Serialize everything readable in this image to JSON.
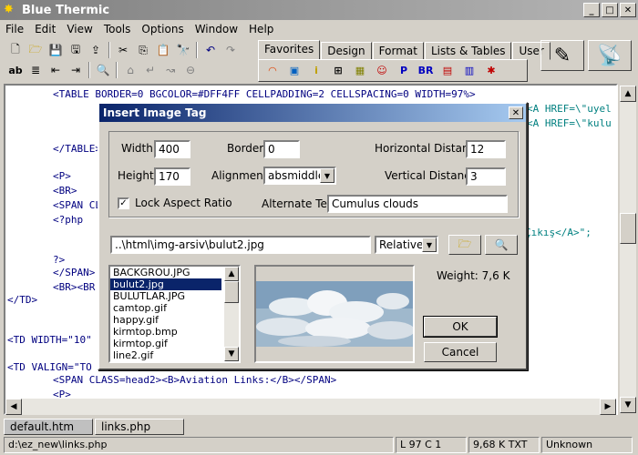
{
  "window": {
    "title": "Blue Thermic"
  },
  "menu": [
    "File",
    "Edit",
    "View",
    "Tools",
    "Options",
    "Window",
    "Help"
  ],
  "tabs": [
    "Favorites",
    "Design",
    "Format",
    "Lists & Tables",
    "User"
  ],
  "tab_icons": {
    "p": "P",
    "br": "BR"
  },
  "editor": {
    "lines": [
      "<TABLE BORDER=0 BGCOLOR=#DFF4FF CELLPADDING=2 CELLSPACING=0 WIDTH=97%>",
      "<A HREF=\\\"uyel",
      "<A HREF=\\\"kulu",
      "</TABLE>",
      "<P>",
      "<BR>",
      "<SPAN CL",
      "<?php",
      "Çıkış</A>\";",
      "?>",
      "</SPAN>",
      "<BR><BR",
      "</TD>",
      "<TD WIDTH=\"10\"",
      "<TD VALIGN=\"TO",
      "<SPAN CLASS=head2><B>Aviation Links:</B></SPAN>",
      "<P>"
    ]
  },
  "doc_tabs": [
    "default.htm",
    "links.php"
  ],
  "status": {
    "path": "d:\\ez_new\\links.php",
    "pos": "L 97  C 1",
    "size": "9,68 K  TXT",
    "enc": "Unknown"
  },
  "dialog": {
    "title": "Insert Image Tag",
    "width_label": "Width:",
    "width": "400",
    "height_label": "Height:",
    "height": "170",
    "border_label": "Border:",
    "border": "0",
    "alignment_label": "Alignment:",
    "alignment": "absmiddle",
    "hdist_label": "Horizontal Distance:",
    "hdist": "12",
    "vdist_label": "Vertical Distance:",
    "vdist": "3",
    "lock_label": "Lock Aspect Ratio",
    "lock_checked": true,
    "alt_label": "Alternate Text:",
    "alt": "Cumulus clouds",
    "path": "..\\html\\img-arsiv\\bulut2.jpg",
    "path_mode": "Relative",
    "files": [
      "BACKGROU.JPG",
      "bulut2.jpg",
      "BULUTLAR.JPG",
      "camtop.gif",
      "happy.gif",
      "kirmtop.bmp",
      "kirmtop.gif",
      "line2.gif"
    ],
    "selected_file": "bulut2.jpg",
    "weight": "Weight: 7,6 K",
    "ok": "OK",
    "cancel": "Cancel"
  }
}
